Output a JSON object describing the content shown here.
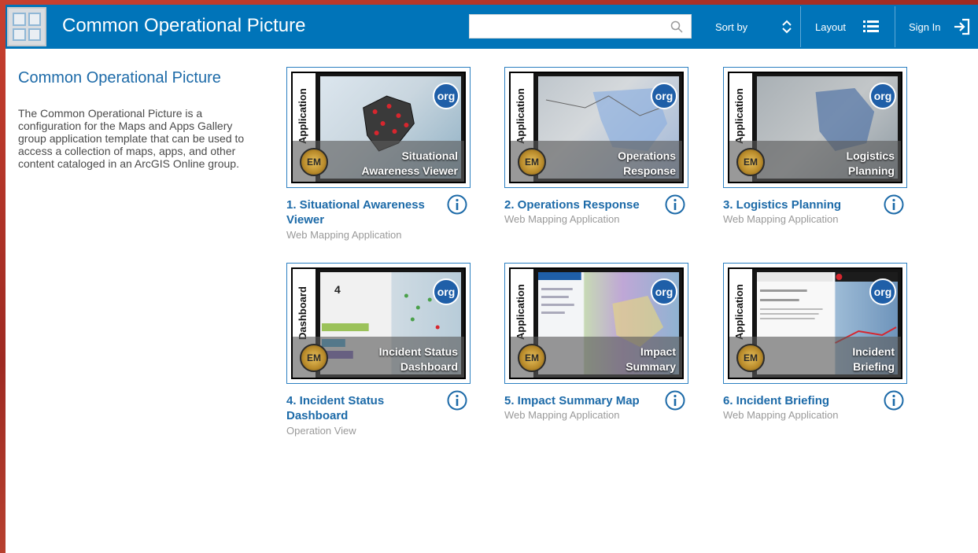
{
  "header": {
    "title": "Common Operational Picture",
    "search_placeholder": "",
    "sort_label": "Sort by",
    "layout_label": "Layout",
    "signin_label": "Sign In"
  },
  "group": {
    "title": "Common Operational Picture",
    "description": "The Common Operational Picture is a configuration for the Maps and Apps Gallery group application template that can be used to access a collection of maps, apps, and other content cataloged in an ArcGIS Online group."
  },
  "thumb_badges": {
    "org": "org",
    "seal": "EM"
  },
  "items": [
    {
      "title": "1. Situational Awareness Viewer",
      "type": "Web Mapping Application",
      "thumb_side": "Application",
      "thumb_caption_1": "Situational",
      "thumb_caption_2": "Awareness Viewer"
    },
    {
      "title": "2. Operations Response",
      "type": "Web Mapping Application",
      "thumb_side": "Application",
      "thumb_caption_1": "Operations",
      "thumb_caption_2": "Response"
    },
    {
      "title": "3. Logistics Planning",
      "type": "Web Mapping Application",
      "thumb_side": "Application",
      "thumb_caption_1": "Logistics",
      "thumb_caption_2": "Planning"
    },
    {
      "title": "4. Incident Status Dashboard",
      "type": "Operation View",
      "thumb_side": "Dashboard",
      "thumb_caption_1": "Incident Status",
      "thumb_caption_2": "Dashboard",
      "thumb_value": "4"
    },
    {
      "title": "5. Impact Summary Map",
      "type": "Web Mapping Application",
      "thumb_side": "Application",
      "thumb_caption_1": "Impact",
      "thumb_caption_2": "Summary"
    },
    {
      "title": "6. Incident Briefing",
      "type": "Web Mapping Application",
      "thumb_side": "Application",
      "thumb_caption_1": "Incident",
      "thumb_caption_2": "Briefing"
    }
  ],
  "colors": {
    "header_bg": "#0074b9",
    "link": "#1c6aa8",
    "muted": "#999999"
  }
}
